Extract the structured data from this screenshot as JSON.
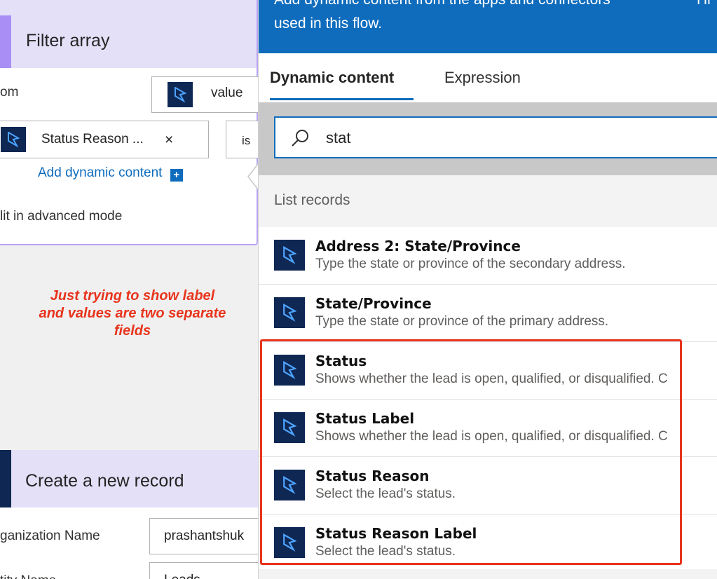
{
  "filter_card": {
    "title": "Filter array",
    "from_label": "om",
    "from_value": "value",
    "token_label": "Status Reason ...",
    "token_close": "×",
    "operator": "is",
    "add_dynamic": "Add dynamic content",
    "advanced_mode": "lit in advanced mode"
  },
  "annotation": {
    "line1": "Just trying to show label",
    "line2": "and values are two separate",
    "line3": "fields"
  },
  "create_card": {
    "title": "Create a new record",
    "org_label": "ganization Name",
    "org_value": "prashantshuk",
    "entity_label": "tity Name",
    "entity_value": "Leads"
  },
  "panel": {
    "description_line1": "Add dynamic content from the apps and connectors",
    "description_line2": "used in this flow.",
    "hide_label": "Hi",
    "tabs": {
      "dynamic": "Dynamic content",
      "expression": "Expression"
    },
    "search": {
      "value": "stat",
      "icon": "search-icon"
    },
    "section_title": "List records",
    "items": [
      {
        "title": "Address 2: State/Province",
        "desc": "Type the state or province of the secondary address."
      },
      {
        "title": "State/Province",
        "desc": "Type the state or province of the primary address."
      },
      {
        "title": "Status",
        "desc": "Shows whether the lead is open, qualified, or disqualified. C"
      },
      {
        "title": "Status Label",
        "desc": "Shows whether the lead is open, qualified, or disqualified. C"
      },
      {
        "title": "Status Reason",
        "desc": "Select the lead's status."
      },
      {
        "title": "Status Reason Label",
        "desc": "Select the lead's status."
      }
    ]
  },
  "colors": {
    "accent_blue": "#0f6cbd",
    "dynamics_navy": "#0f2753",
    "filter_purple": "#a98ff5",
    "highlight_red": "#e8341c"
  }
}
